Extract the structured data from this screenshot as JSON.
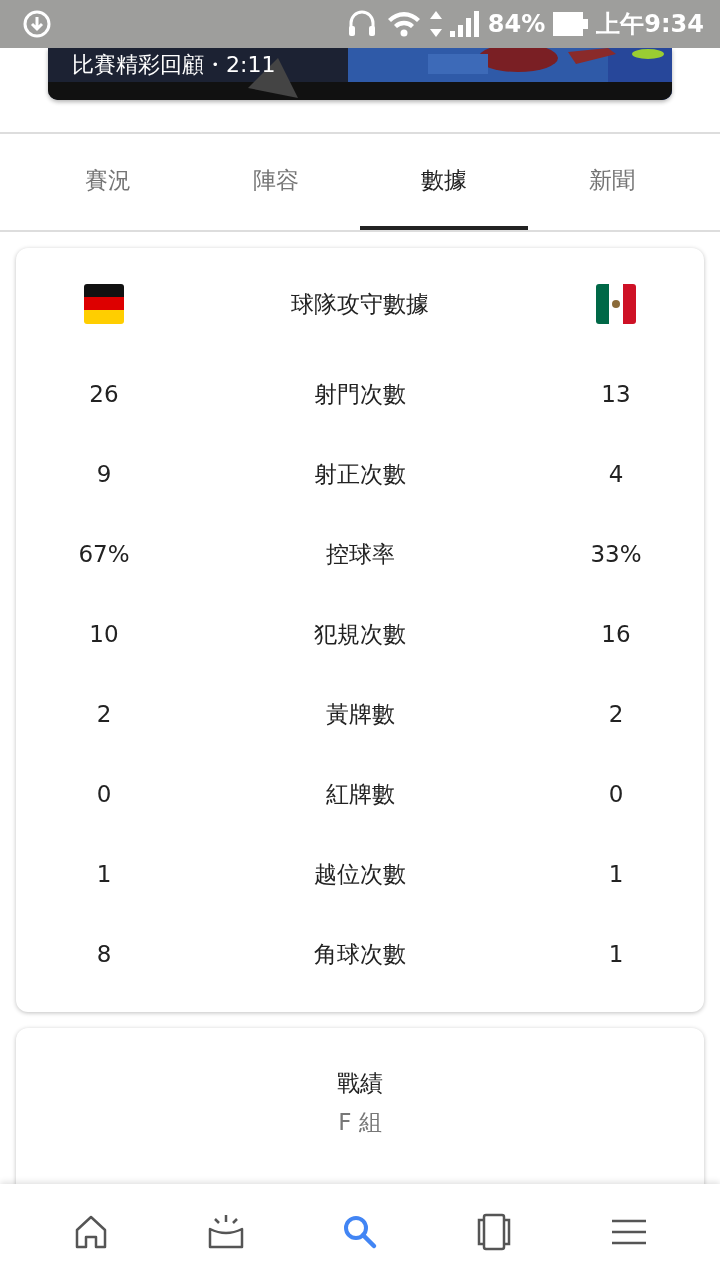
{
  "status_bar": {
    "battery": "84%",
    "time": "上午9:34"
  },
  "video": {
    "kind": "picture",
    "caption": "比賽精彩回顧・2:11"
  },
  "tabs": [
    {
      "label": "賽況",
      "selected": false
    },
    {
      "label": "陣容",
      "selected": false
    },
    {
      "label": "數據",
      "selected": true
    },
    {
      "label": "新聞",
      "selected": false
    }
  ],
  "stats": {
    "title": "球隊攻守數據",
    "rows": [
      {
        "home": "26",
        "label": "射門次數",
        "away": "13"
      },
      {
        "home": "9",
        "label": "射正次數",
        "away": "4"
      },
      {
        "home": "67%",
        "label": "控球率",
        "away": "33%"
      },
      {
        "home": "10",
        "label": "犯規次數",
        "away": "16"
      },
      {
        "home": "2",
        "label": "黃牌數",
        "away": "2"
      },
      {
        "home": "0",
        "label": "紅牌數",
        "away": "0"
      },
      {
        "home": "1",
        "label": "越位次數",
        "away": "1"
      },
      {
        "home": "8",
        "label": "角球次數",
        "away": "1"
      }
    ]
  },
  "record": {
    "title": "戰績",
    "group": "F 組"
  },
  "bottom_nav": [
    {
      "kind": "home",
      "selected": false
    },
    {
      "kind": "updates",
      "selected": false
    },
    {
      "kind": "search",
      "selected": true
    },
    {
      "kind": "collections",
      "selected": false
    },
    {
      "kind": "menu",
      "selected": false
    }
  ]
}
